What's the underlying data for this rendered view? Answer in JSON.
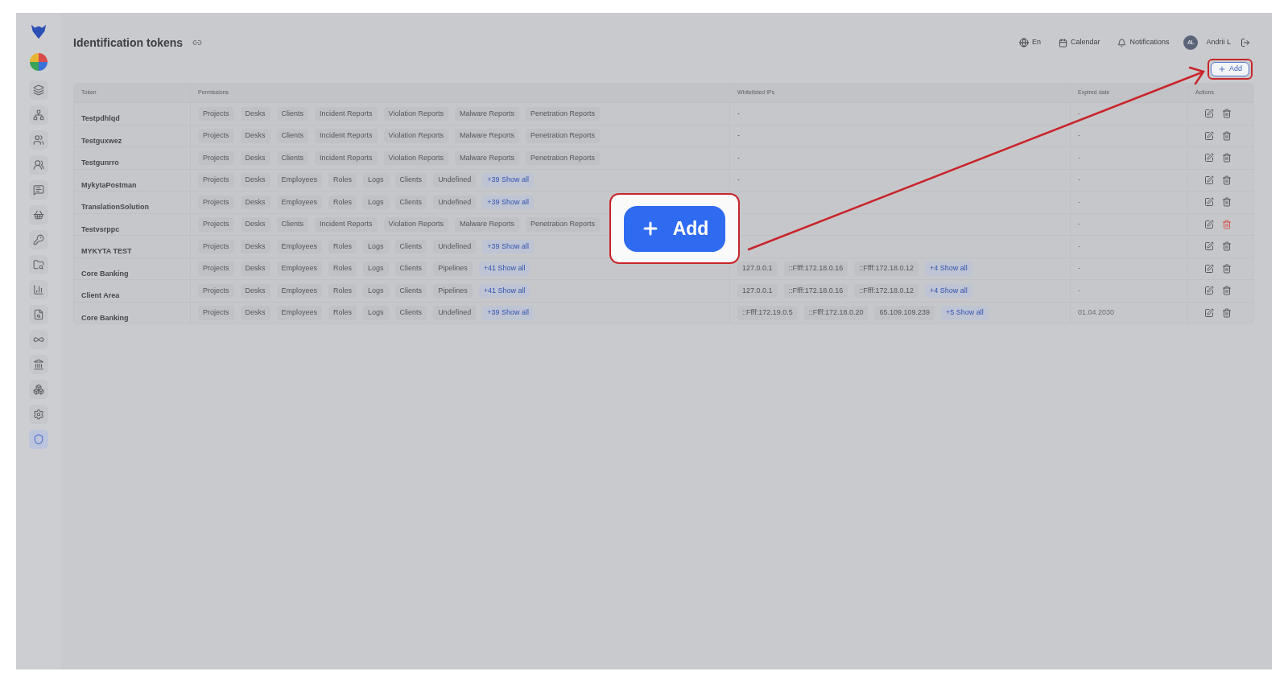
{
  "sidebar": {
    "items": [
      {
        "selected": false
      },
      {
        "selected": false
      },
      {
        "selected": false
      },
      {
        "selected": false
      },
      {
        "selected": false
      },
      {
        "selected": false
      },
      {
        "selected": false
      },
      {
        "selected": false
      },
      {
        "selected": false
      },
      {
        "selected": false
      },
      {
        "selected": false
      },
      {
        "selected": false
      },
      {
        "selected": false
      },
      {
        "selected": false
      },
      {
        "selected": true
      }
    ]
  },
  "header": {
    "title": "Identification tokens",
    "language": "En",
    "calendar": "Calendar",
    "notifications": "Notifications",
    "avatar": "AL",
    "user": "Andrii L"
  },
  "add_button": {
    "label": "Add",
    "highlighted": true
  },
  "table": {
    "columns": [
      "Token",
      "Permissions",
      "Whitelisted IPs",
      "Expired date",
      "Actions"
    ],
    "rows": [
      {
        "token": "Testpdhlqd",
        "permissions": [
          {
            "kind": "tag",
            "text": "Projects"
          },
          {
            "kind": "tag",
            "text": "Desks"
          },
          {
            "kind": "tag",
            "text": "Clients"
          },
          {
            "kind": "tag",
            "text": "Incident Reports"
          },
          {
            "kind": "tag",
            "text": "Violation Reports"
          },
          {
            "kind": "tag",
            "text": "Malware Reports"
          },
          {
            "kind": "tag",
            "text": "Penetration Reports"
          }
        ],
        "ips": [
          {
            "kind": "text",
            "text": "-"
          }
        ],
        "expired": "-",
        "delete_hovered": false
      },
      {
        "token": "Testguxwez",
        "permissions": [
          {
            "kind": "tag",
            "text": "Projects"
          },
          {
            "kind": "tag",
            "text": "Desks"
          },
          {
            "kind": "tag",
            "text": "Clients"
          },
          {
            "kind": "tag",
            "text": "Incident Reports"
          },
          {
            "kind": "tag",
            "text": "Violation Reports"
          },
          {
            "kind": "tag",
            "text": "Malware Reports"
          },
          {
            "kind": "tag",
            "text": "Penetration Reports"
          }
        ],
        "ips": [
          {
            "kind": "text",
            "text": "-"
          }
        ],
        "expired": "-",
        "delete_hovered": false
      },
      {
        "token": "Testgunrro",
        "permissions": [
          {
            "kind": "tag",
            "text": "Projects"
          },
          {
            "kind": "tag",
            "text": "Desks"
          },
          {
            "kind": "tag",
            "text": "Clients"
          },
          {
            "kind": "tag",
            "text": "Incident Reports"
          },
          {
            "kind": "tag",
            "text": "Violation Reports"
          },
          {
            "kind": "tag",
            "text": "Malware Reports"
          },
          {
            "kind": "tag",
            "text": "Penetration Reports"
          }
        ],
        "ips": [
          {
            "kind": "text",
            "text": "-"
          }
        ],
        "expired": "-",
        "delete_hovered": false
      },
      {
        "token": "MykytaPostman",
        "permissions": [
          {
            "kind": "tag",
            "text": "Projects"
          },
          {
            "kind": "tag",
            "text": "Desks"
          },
          {
            "kind": "tag",
            "text": "Employees"
          },
          {
            "kind": "tag",
            "text": "Roles"
          },
          {
            "kind": "tag",
            "text": "Logs"
          },
          {
            "kind": "tag",
            "text": "Clients"
          },
          {
            "kind": "tag",
            "text": "Undefined"
          },
          {
            "kind": "more",
            "text": "+39 Show all"
          }
        ],
        "ips": [
          {
            "kind": "text",
            "text": "-"
          }
        ],
        "expired": "-",
        "delete_hovered": false
      },
      {
        "token": "TranslationSolution",
        "permissions": [
          {
            "kind": "tag",
            "text": "Projects"
          },
          {
            "kind": "tag",
            "text": "Desks"
          },
          {
            "kind": "tag",
            "text": "Employees"
          },
          {
            "kind": "tag",
            "text": "Roles"
          },
          {
            "kind": "tag",
            "text": "Logs"
          },
          {
            "kind": "tag",
            "text": "Clients"
          },
          {
            "kind": "tag",
            "text": "Undefined"
          },
          {
            "kind": "more",
            "text": "+39 Show all"
          }
        ],
        "ips": [],
        "expired": "-",
        "delete_hovered": false
      },
      {
        "token": "Testvsrppc",
        "permissions": [
          {
            "kind": "tag",
            "text": "Projects"
          },
          {
            "kind": "tag",
            "text": "Desks"
          },
          {
            "kind": "tag",
            "text": "Clients"
          },
          {
            "kind": "tag",
            "text": "Incident Reports"
          },
          {
            "kind": "tag",
            "text": "Violation Reports"
          },
          {
            "kind": "tag",
            "text": "Malware Reports"
          },
          {
            "kind": "tag",
            "text": "Penetration Reports"
          }
        ],
        "ips": [],
        "expired": "-",
        "delete_hovered": true
      },
      {
        "token": "MYKYTA TEST",
        "permissions": [
          {
            "kind": "tag",
            "text": "Projects"
          },
          {
            "kind": "tag",
            "text": "Desks"
          },
          {
            "kind": "tag",
            "text": "Employees"
          },
          {
            "kind": "tag",
            "text": "Roles"
          },
          {
            "kind": "tag",
            "text": "Logs"
          },
          {
            "kind": "tag",
            "text": "Clients"
          },
          {
            "kind": "tag",
            "text": "Undefined"
          },
          {
            "kind": "more",
            "text": "+39 Show all"
          }
        ],
        "ips": [],
        "expired": "-",
        "delete_hovered": false
      },
      {
        "token": "Core Banking",
        "permissions": [
          {
            "kind": "tag",
            "text": "Projects"
          },
          {
            "kind": "tag",
            "text": "Desks"
          },
          {
            "kind": "tag",
            "text": "Employees"
          },
          {
            "kind": "tag",
            "text": "Roles"
          },
          {
            "kind": "tag",
            "text": "Logs"
          },
          {
            "kind": "tag",
            "text": "Clients"
          },
          {
            "kind": "tag",
            "text": "Pipelines"
          },
          {
            "kind": "more",
            "text": "+41 Show all"
          }
        ],
        "ips": [
          {
            "kind": "tag",
            "text": "127.0.0.1"
          },
          {
            "kind": "tag",
            "text": "::Ffff:172.18.0.16"
          },
          {
            "kind": "tag",
            "text": "::Ffff:172.18.0.12"
          },
          {
            "kind": "more",
            "text": "+4 Show all"
          }
        ],
        "expired": "-",
        "delete_hovered": false
      },
      {
        "token": "Client Area",
        "permissions": [
          {
            "kind": "tag",
            "text": "Projects"
          },
          {
            "kind": "tag",
            "text": "Desks"
          },
          {
            "kind": "tag",
            "text": "Employees"
          },
          {
            "kind": "tag",
            "text": "Roles"
          },
          {
            "kind": "tag",
            "text": "Logs"
          },
          {
            "kind": "tag",
            "text": "Clients"
          },
          {
            "kind": "tag",
            "text": "Pipelines"
          },
          {
            "kind": "more",
            "text": "+41 Show all"
          }
        ],
        "ips": [
          {
            "kind": "tag",
            "text": "127.0.0.1"
          },
          {
            "kind": "tag",
            "text": "::Ffff:172.18.0.16"
          },
          {
            "kind": "tag",
            "text": "::Ffff:172.18.0.12"
          },
          {
            "kind": "more",
            "text": "+4 Show all"
          }
        ],
        "expired": "-",
        "delete_hovered": false
      },
      {
        "token": "Core Banking",
        "permissions": [
          {
            "kind": "tag",
            "text": "Projects"
          },
          {
            "kind": "tag",
            "text": "Desks"
          },
          {
            "kind": "tag",
            "text": "Employees"
          },
          {
            "kind": "tag",
            "text": "Roles"
          },
          {
            "kind": "tag",
            "text": "Logs"
          },
          {
            "kind": "tag",
            "text": "Clients"
          },
          {
            "kind": "tag",
            "text": "Undefined"
          },
          {
            "kind": "more",
            "text": "+39 Show all"
          }
        ],
        "ips": [
          {
            "kind": "tag",
            "text": "::Ffff:172.19.0.5"
          },
          {
            "kind": "tag",
            "text": "::Ffff:172.18.0.20"
          },
          {
            "kind": "tag",
            "text": "65.109.109.239"
          },
          {
            "kind": "more",
            "text": "+5 Show all"
          }
        ],
        "expired": "01.04.2030",
        "delete_hovered": false
      }
    ]
  },
  "callout": {
    "label": "Add"
  }
}
